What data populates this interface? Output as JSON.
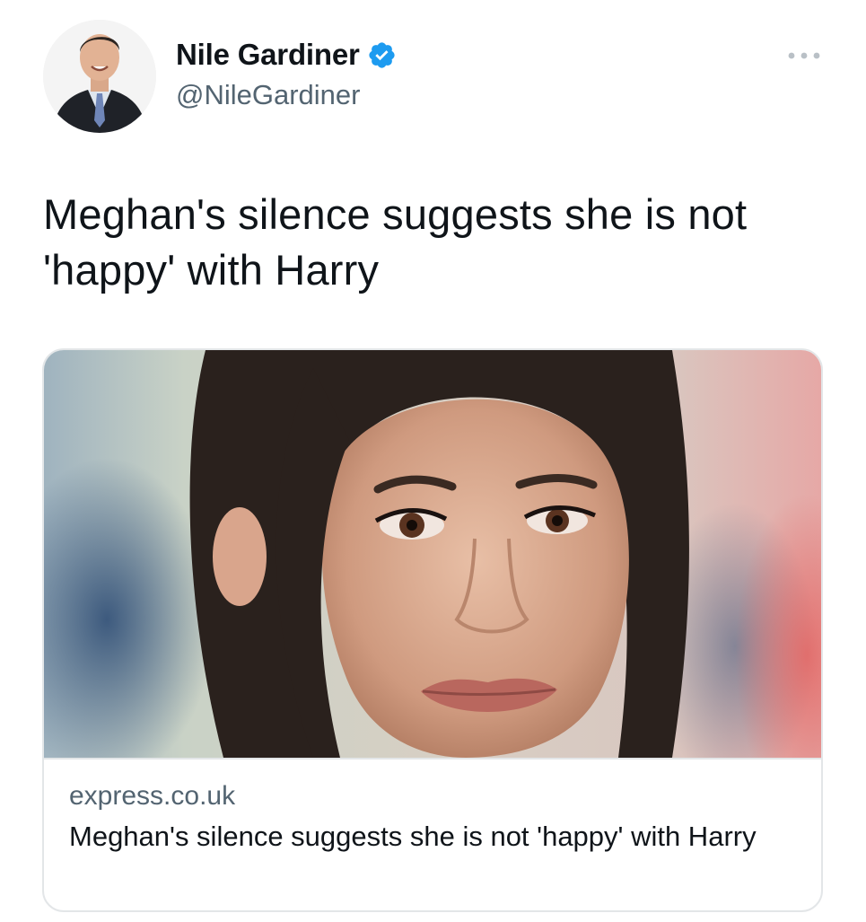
{
  "tweet": {
    "author": {
      "display_name": "Nile Gardiner",
      "handle": "@NileGardiner",
      "verified": true,
      "avatar_icon": "profile-photo"
    },
    "more_icon": "more-horizontal-icon",
    "text": "Meghan's silence suggests she is not 'happy' with Harry",
    "link_card": {
      "image": "photo of woman with dark hair",
      "domain": "express.co.uk",
      "title": "Meghan's silence suggests she is not 'happy' with Harry"
    }
  },
  "colors": {
    "text_primary": "#0f1419",
    "text_secondary": "#536471",
    "verified_blue": "#1d9bf0",
    "border": "#e3e6e8"
  }
}
